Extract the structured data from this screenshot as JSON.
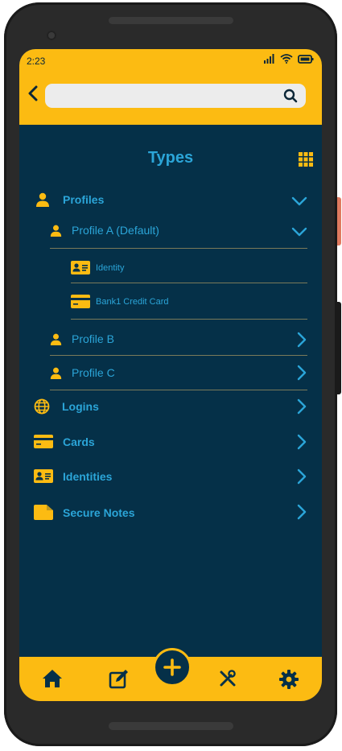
{
  "status": {
    "time": "2:23"
  },
  "search": {
    "placeholder": "",
    "value": ""
  },
  "page": {
    "title": "Types"
  },
  "tree": {
    "profiles_label": "Profiles",
    "profile_a_label": "Profile A (Default)",
    "identity_label": "Identity",
    "credit_card_label": "Bank1 Credit Card",
    "profile_b_label": "Profile B",
    "profile_c_label": "Profile C",
    "logins_label": "Logins",
    "cards_label": "Cards",
    "identities_label": "Identities",
    "secure_notes_label": "Secure Notes"
  },
  "icons": {
    "back": "chevron-left-icon",
    "search": "search-icon",
    "grid": "grid-icon",
    "person": "person-icon",
    "id_card": "id-card-icon",
    "credit_card": "credit-card-icon",
    "globe": "globe-icon",
    "note": "note-icon",
    "home": "home-icon",
    "edit": "edit-icon",
    "add": "plus-icon",
    "tools": "tools-icon",
    "settings": "gear-icon"
  },
  "colors": {
    "accent": "#fcbb12",
    "background": "#053048",
    "text": "#2ba5d8"
  }
}
